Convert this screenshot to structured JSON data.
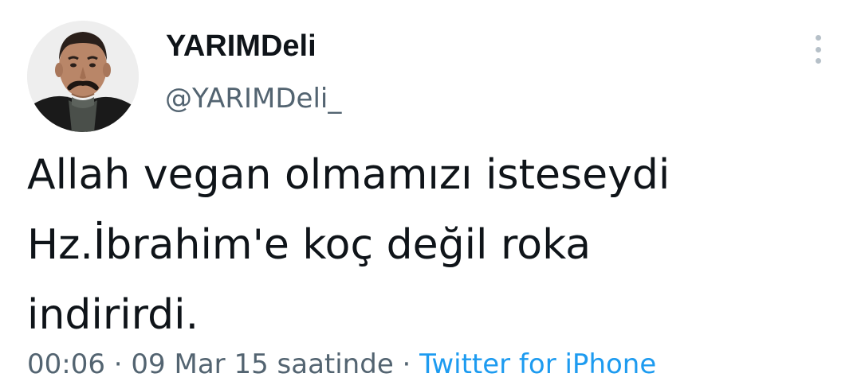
{
  "tweet": {
    "author": {
      "display_name": "YARIMDeli",
      "handle": "@YARIMDeli_"
    },
    "text_lines": [
      "Allah vegan olmamızı isteseydi",
      "Hz.İbrahim'e koç değil roka",
      "indirirdi."
    ],
    "meta": {
      "time": "00:06",
      "separator": "·",
      "date": "09 Mar 15 saatinde",
      "source": "Twitter for iPhone"
    },
    "icons": {
      "more": "more-vertical-icon"
    },
    "colors": {
      "text": "#0f1419",
      "secondary": "#536471",
      "link": "#1d9bf0",
      "more_dots": "#b6c0c8"
    }
  }
}
